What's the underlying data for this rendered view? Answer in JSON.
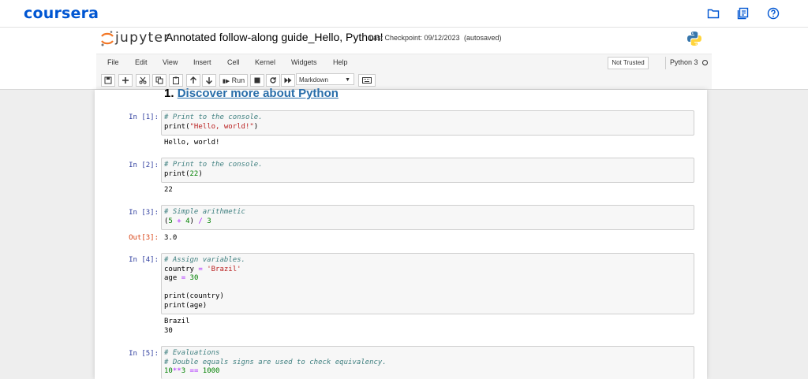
{
  "coursera": {
    "logo": "coursera",
    "icons": [
      "folder-icon",
      "notes-icon",
      "help-icon"
    ],
    "brand_color": "#0056d2"
  },
  "jupyter": {
    "name": "jupyter",
    "notebook_title": "Annotated follow-along guide_Hello, Python!",
    "checkpoint": "Last Checkpoint: 09/12/2023",
    "autosave": "(autosaved)"
  },
  "menu": [
    "File",
    "Edit",
    "View",
    "Insert",
    "Cell",
    "Kernel",
    "Widgets",
    "Help"
  ],
  "status": {
    "trusted": "Not Trusted",
    "kernel": "Python 3"
  },
  "toolbar": {
    "run_label": "Run",
    "cell_type": "Markdown"
  },
  "heading": {
    "prefix": "1.",
    "link": "Discover more about Python"
  },
  "cells": [
    {
      "prompt": "In [1]:",
      "lines": [
        "# Print to the console.",
        "print(\"Hello, world!\")"
      ],
      "output": "Hello, world!"
    },
    {
      "prompt": "In [2]:",
      "lines": [
        "# Print to the console.",
        "print(22)"
      ],
      "output": "22"
    },
    {
      "prompt": "In [3]:",
      "lines": [
        "# Simple arithmetic",
        "(5 + 4) / 3"
      ],
      "out_prompt": "Out[3]:",
      "output": "3.0"
    },
    {
      "prompt": "In [4]:",
      "lines": [
        "# Assign variables.",
        "country = 'Brazil'",
        "age = 30",
        "",
        "print(country)",
        "print(age)"
      ],
      "output": "Brazil\n30"
    },
    {
      "prompt": "In [5]:",
      "lines": [
        "# Evaluations",
        "# Double equals signs are used to check equivalency.",
        "10**3 == 1000"
      ]
    }
  ]
}
